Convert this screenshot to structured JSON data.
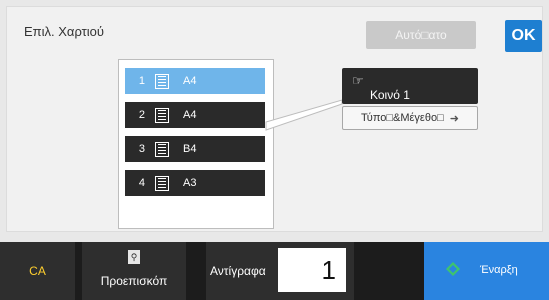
{
  "header": {
    "title": "Επιλ. Χαρτιού",
    "auto_label": "Αυτό□ατο",
    "ok_label": "OK"
  },
  "trays": [
    {
      "num": "1",
      "size": "A4"
    },
    {
      "num": "2",
      "size": "A4"
    },
    {
      "num": "3",
      "size": "B4"
    },
    {
      "num": "4",
      "size": "A3"
    }
  ],
  "paper_type": {
    "label": "Κοινό 1",
    "type_button": "Τύπο□&Μέγεθο□"
  },
  "bottom": {
    "ca": "CA",
    "preview": "Προεπισκόπ",
    "copies_label": "Αντίγραφα",
    "copies_value": "1",
    "start": "Έναρξη"
  },
  "colors": {
    "selected_tray": "#6fb5ea",
    "accent": "#1e7fd1",
    "start": "#2a84e0",
    "ca_text": "#ffcf2e"
  }
}
